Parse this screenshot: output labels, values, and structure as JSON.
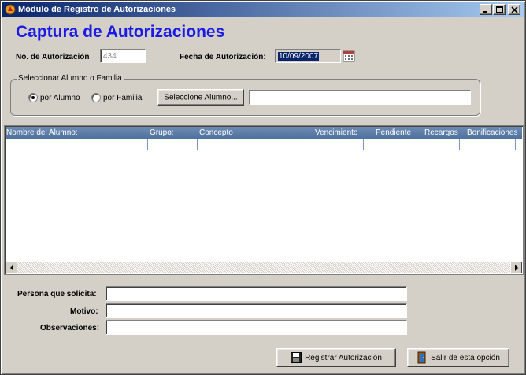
{
  "window": {
    "title": "Módulo de Registro de Autorizaciones"
  },
  "heading": "Captura de Autorizaciones",
  "auth": {
    "number_label": "No. de Autorización",
    "number_value": "434",
    "date_label": "Fecha de Autorización:",
    "date_value": "10/09/2007"
  },
  "select_group": {
    "title": "Seleccionar Alumno o Familia",
    "radio_alumno": "por Alumno",
    "radio_familia": "por Familia",
    "selected": "por Alumno",
    "select_button": "Seleccione Alumno...",
    "selection_value": ""
  },
  "grid": {
    "columns": [
      "Nombre del Alumno:",
      "Grupo:",
      "Concepto",
      "Vencimiento",
      "Pendiente",
      "Recargos",
      "Bonificaciones"
    ],
    "rows": []
  },
  "form": {
    "persona_label": "Persona que solicita:",
    "persona_value": "",
    "motivo_label": "Motivo:",
    "motivo_value": "",
    "observaciones_label": "Observaciones:",
    "observaciones_value": ""
  },
  "actions": {
    "register_label": "Registrar Autorización",
    "exit_label": "Salir de esta opción"
  },
  "colors": {
    "heading": "#1a1ae6",
    "titlebar_start": "#0a246a",
    "grid_header": "#5a7aa8"
  }
}
